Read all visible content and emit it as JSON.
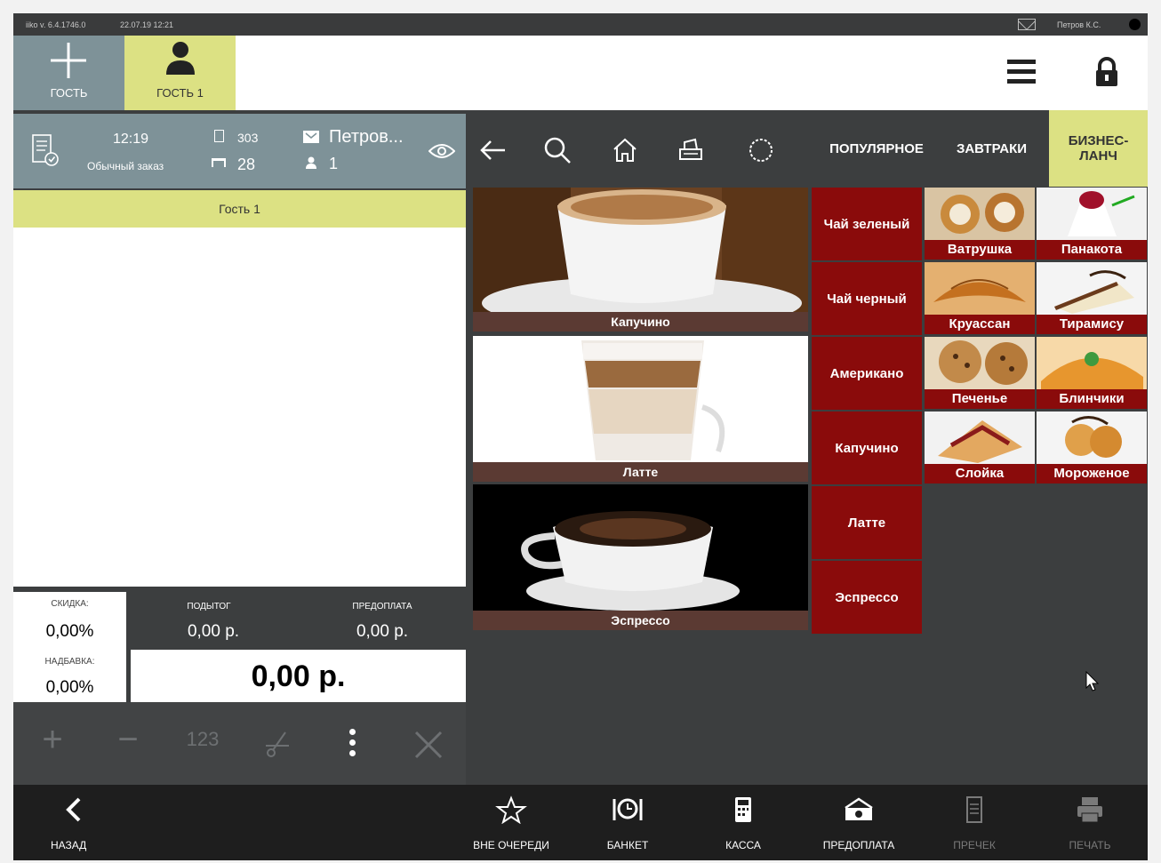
{
  "status": {
    "version": "iiko v. 6.4.1746.0",
    "datetime": "22.07.19  12:21",
    "user": "Петров К.С."
  },
  "header": {
    "add_guest_label": "ГОСТЬ",
    "guest_tab_label": "ГОСТЬ 1"
  },
  "order": {
    "time": "12:19",
    "type": "Обычный заказ",
    "number": "303",
    "table": "28",
    "waiter": "Петров...",
    "guests": "1",
    "guest_name": "Гость 1"
  },
  "totals": {
    "discount_label": "СКИДКА:",
    "discount_value": "0,00%",
    "surcharge_label": "НАДБАВКА:",
    "surcharge_value": "0,00%",
    "subtotal_label": "ПОДЫТОГ",
    "subtotal_value": "0,00 р.",
    "prepay_label": "ПРЕДОПЛАТА",
    "prepay_value": "0,00 р.",
    "total_value": "0,00 р."
  },
  "tools": {
    "numpad_label": "123"
  },
  "menu": {
    "categories": [
      "ПОПУЛЯРНОЕ",
      "ЗАВТРАКИ",
      "БИЗНЕС-ЛАНЧ"
    ],
    "featured": [
      "Капучино",
      "Латте",
      "Эспрессо"
    ],
    "drinks": [
      "Чай зеленый",
      "Чай черный",
      "Американо",
      "Капучино",
      "Латте",
      "Эспрессо"
    ],
    "desserts": [
      "Ватрушка",
      "Панакота",
      "Круассан",
      "Тирамису",
      "Печенье",
      "Блинчики",
      "Слойка",
      "Мороженое"
    ]
  },
  "bottom": {
    "back": "НАЗАД",
    "queue": "ВНЕ ОЧЕРЕДИ",
    "banquet": "БАНКЕТ",
    "cash": "КАССА",
    "prepayment": "ПРЕДОПЛАТА",
    "precheck": "ПРЕЧЕК",
    "print": "ПЕЧАТЬ"
  },
  "colors": {
    "accent": "#dce183",
    "panel": "#7e9298",
    "red": "#8a0b0b",
    "caption": "#5b3a33",
    "dark": "#3c3e3f"
  },
  "icons": [
    "plus-icon",
    "person-icon",
    "menu-icon",
    "lock-icon",
    "receipt-icon",
    "eye-icon",
    "back-arrow-icon",
    "search-icon",
    "home-icon",
    "printer-icon",
    "circle-icon",
    "star-icon",
    "cutlery-clock-icon",
    "calculator-icon",
    "money-icon"
  ]
}
